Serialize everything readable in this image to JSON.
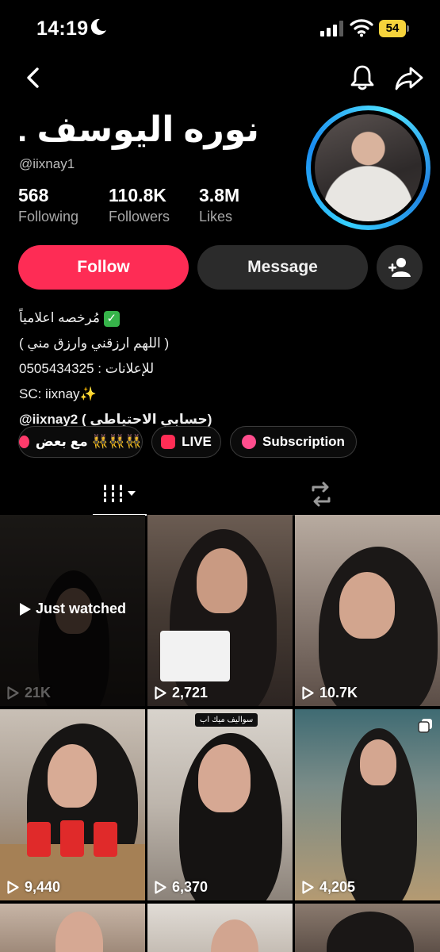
{
  "status_bar": {
    "time": "14:19",
    "battery": "54"
  },
  "profile": {
    "display_name": "نوره اليوسف .",
    "username": "@iixnay1",
    "stats": [
      {
        "value": "568",
        "label": "Following"
      },
      {
        "value": "110.8K",
        "label": "Followers"
      },
      {
        "value": "3.8M",
        "label": "Likes"
      }
    ]
  },
  "actions": {
    "follow": "Follow",
    "message": "Message"
  },
  "bio": [
    "مُرخصه اعلامياً",
    "( اللهم ارزقني وارزق مني )",
    "للإعلانات : 0505434325",
    "SC: iixnay✨",
    "@iixnay2 ( حسابي الاحتياطي)"
  ],
  "chips": [
    {
      "label": "مع بعض 👯‍♀️👯‍♀️👯‍♀️",
      "icon": "group-icon",
      "color": "#ff3b6b"
    },
    {
      "label": "LIVE",
      "icon": "live-icon",
      "color": "#ff2d55"
    },
    {
      "label": "Subscription",
      "icon": "subscription-icon",
      "color": "#ff4d8d"
    }
  ],
  "videos": [
    {
      "views": "21K",
      "overlay": "Just watched"
    },
    {
      "views": "2,721"
    },
    {
      "views": "10.7K"
    },
    {
      "views": "9,440"
    },
    {
      "views": "6,370",
      "caption": "سواليف ميك اب"
    },
    {
      "views": "4,205"
    }
  ],
  "colors": {
    "follow": "#fe2c55",
    "ring": "#36d0ff"
  }
}
